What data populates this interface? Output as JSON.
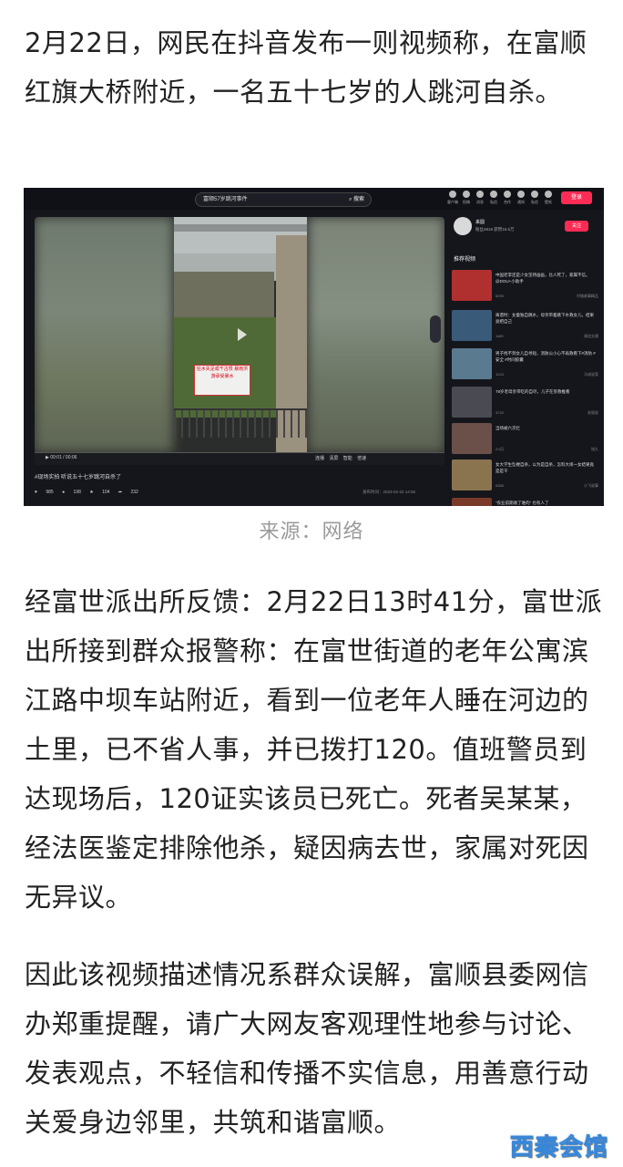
{
  "article": {
    "paragraph1": "2月22日，网民在抖音发布一则视频称，在富顺红旗大桥附近，一名五十七岁的人跳河自杀。",
    "caption": "来源：网络",
    "paragraph2": "经富世派出所反馈：2月22日13时41分，富世派出所接到群众报警称：在富世街道的老年公寓滨江路中坝车站附近，看到一位老年人睡在河边的土里，已不省人事，并已拨打120。值班警员到达现场后，120证实该员已死亡。死者吴某某，经法医鉴定排除他杀，疑因病去世，家属对死因无异议。",
    "paragraph3": "因此该视频描述情况系群众误解，富顺县委网信办郑重提醒，请广大网友客观理性地参与讨论、发表观点，不轻信和传播不实信息，用善意行动关爱身边邻里，共筑和谐富顺。"
  },
  "screenshot": {
    "search_query": "富顺57岁跳河事件",
    "search_button": "搜索",
    "nav": [
      "客户端",
      "投稿",
      "消息",
      "私信",
      "合作",
      "通知",
      "私信",
      "壁纸"
    ],
    "login_button": "登录",
    "sign_text": "狂水失足或千古恨 暴雨洪游承受暴水",
    "time_display": "00:01 / 00:06",
    "controls": "连播 清屏 智能 倍速",
    "video_title": "#现场实拍 听说五十七岁跳河自杀了",
    "likes": "985",
    "comments": "198",
    "favorites": "104",
    "shares": "232",
    "publish_meta": "发布时间：2023-02-22 14:56",
    "author_name": "来圆",
    "author_stats": "粉丝4818 获赞16.5万",
    "follow_button": "关注",
    "recommend_title": "推荐视频",
    "recommended": [
      {
        "text": "中国老李还是少女坚持画画，比人死了，家属不信。@DOU+小助手",
        "stat": "5293",
        "author": "村城故事精品"
      },
      {
        "text": "离谱时：女童独自跳水，母亲带着跳下水救女儿，结果竟把自己",
        "stat": "1189",
        "author": "湖北交通"
      },
      {
        "text": "男子找不到女儿自寻短，消防公小心不再救看下#消防 #安全 #时间胶囊",
        "stat": "1224",
        "author": "马成说案"
      },
      {
        "text": "78岁老母亲带吃的自尽，儿子在旁救推看",
        "stat": "3720",
        "author": "苏丽说"
      },
      {
        "text": "当场被六次拦",
        "stat": "2.6万",
        "author": "钱九"
      },
      {
        "text": "女大学生坠楼自杀，以为是自杀，怎料大坝一女结果竟是是干",
        "stat": "5365",
        "author": "小飞说事"
      }
    ],
    "recommended_more": "\"农业前期收了谁的\" 也有人了"
  },
  "watermark": "西秦会馆",
  "colors": {
    "accent": "#fe2c55",
    "watermark_blue": "#3a86d6",
    "watermark_orange": "#f39a2a"
  }
}
